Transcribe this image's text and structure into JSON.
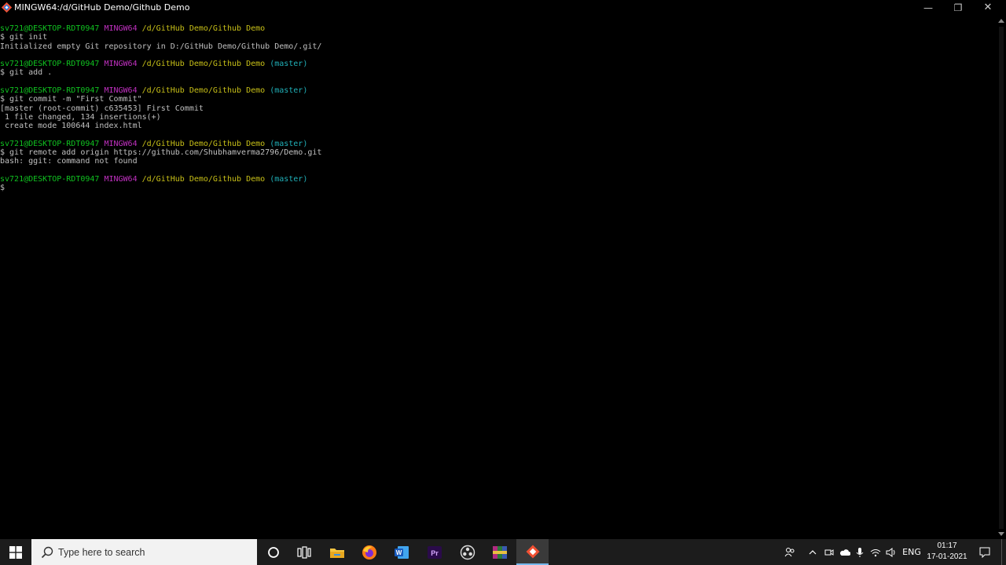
{
  "window": {
    "title": "MINGW64:/d/GitHub Demo/Github Demo",
    "controls": {
      "minimize": "—",
      "maximize": "❐",
      "close": "✕"
    }
  },
  "terminal": {
    "lines": [
      [
        {
          "t": "sv721@DESKTOP-RDT0947 ",
          "c": "g"
        },
        {
          "t": "MINGW64 ",
          "c": "m"
        },
        {
          "t": "/d/GitHub Demo/Github Demo",
          "c": "y"
        }
      ],
      [
        {
          "t": "$ git init",
          "c": "w"
        }
      ],
      [
        {
          "t": "Initialized empty Git repository in D:/GitHub Demo/Github Demo/.git/",
          "c": "w"
        }
      ],
      [],
      [
        {
          "t": "sv721@DESKTOP-RDT0947 ",
          "c": "g"
        },
        {
          "t": "MINGW64 ",
          "c": "m"
        },
        {
          "t": "/d/GitHub Demo/Github Demo ",
          "c": "y"
        },
        {
          "t": "(master)",
          "c": "c"
        }
      ],
      [
        {
          "t": "$ git add .",
          "c": "w"
        }
      ],
      [],
      [
        {
          "t": "sv721@DESKTOP-RDT0947 ",
          "c": "g"
        },
        {
          "t": "MINGW64 ",
          "c": "m"
        },
        {
          "t": "/d/GitHub Demo/Github Demo ",
          "c": "y"
        },
        {
          "t": "(master)",
          "c": "c"
        }
      ],
      [
        {
          "t": "$ git commit -m \"First Commit\"",
          "c": "w"
        }
      ],
      [
        {
          "t": "[master (root-commit) c635453] First Commit",
          "c": "w"
        }
      ],
      [
        {
          "t": " 1 file changed, 134 insertions(+)",
          "c": "w"
        }
      ],
      [
        {
          "t": " create mode 100644 index.html",
          "c": "w"
        }
      ],
      [],
      [
        {
          "t": "sv721@DESKTOP-RDT0947 ",
          "c": "g"
        },
        {
          "t": "MINGW64 ",
          "c": "m"
        },
        {
          "t": "/d/GitHub Demo/Github Demo ",
          "c": "y"
        },
        {
          "t": "(master)",
          "c": "c"
        }
      ],
      [
        {
          "t": "$ git remote add origin https://github.com/Shubhamverma2796/Demo.git",
          "c": "w"
        }
      ],
      [
        {
          "t": "bash: ggit: command not found",
          "c": "w"
        }
      ],
      [],
      [
        {
          "t": "sv721@DESKTOP-RDT0947 ",
          "c": "g"
        },
        {
          "t": "MINGW64 ",
          "c": "m"
        },
        {
          "t": "/d/GitHub Demo/Github Demo ",
          "c": "y"
        },
        {
          "t": "(master)",
          "c": "c"
        }
      ],
      [
        {
          "t": "$",
          "c": "w"
        }
      ]
    ]
  },
  "taskbar": {
    "search_placeholder": "Type here to search",
    "pinned": [
      "cortana-icon",
      "task-view-icon",
      "file-explorer-icon",
      "firefox-icon",
      "word-icon",
      "premiere-pro-icon",
      "obs-icon",
      "winrar-icon",
      "git-bash-icon"
    ],
    "premiere_label": "Pr",
    "word_label": "W",
    "language": "ENG",
    "time": "01:17",
    "date": "17-01-2021"
  },
  "colors": {
    "prompt_user": "#10c220",
    "prompt_env": "#c030c0",
    "prompt_path": "#c8c018",
    "prompt_branch": "#20b0b8",
    "text": "#c0c0c0",
    "taskbar": "#1c1c1c"
  }
}
